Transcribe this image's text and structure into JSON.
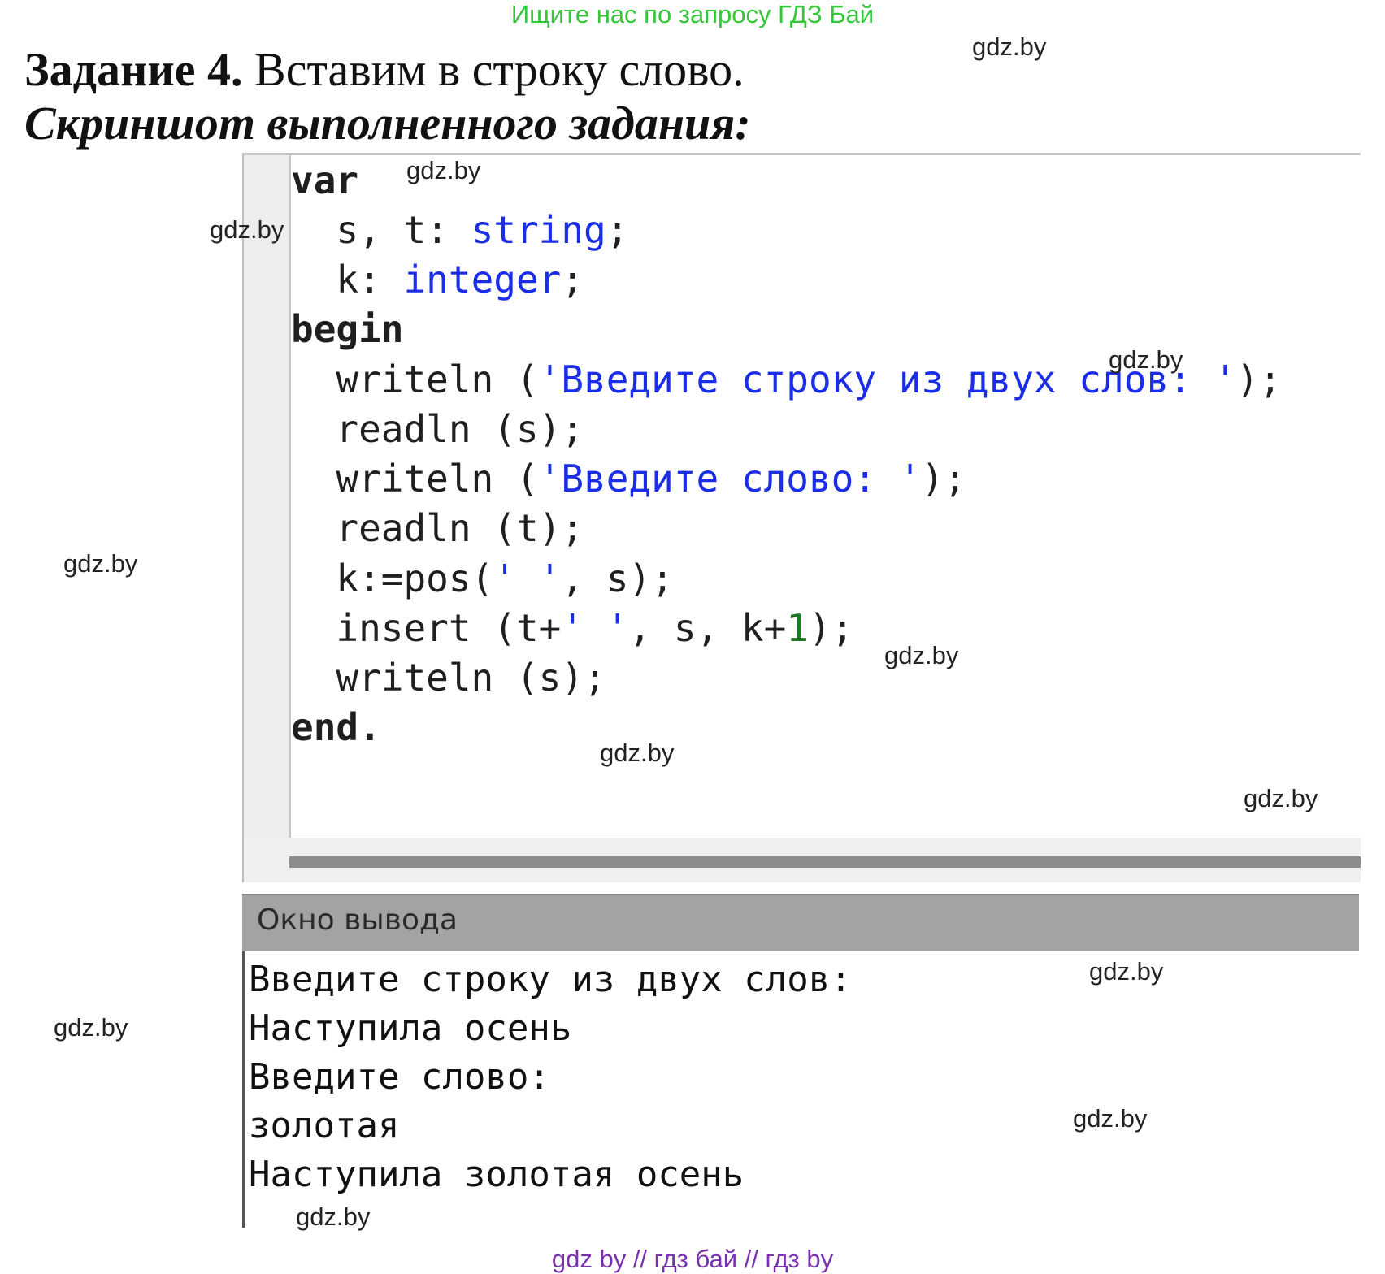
{
  "banner_top": "Ищите нас по запросу ГДЗ Бай",
  "banner_bottom": "gdz by  //  гдз бай  //  гдз by",
  "heading": {
    "bold": "Задание 4.",
    "text": " Вставим в строку слово."
  },
  "subheading": "Скриншот выполненного задания:",
  "watermark": "gdz.by",
  "code": {
    "l1_kw": "var",
    "l2_pre": "  s, t: ",
    "l2_type": "string",
    "l2_post": ";",
    "l3_pre": "  k: ",
    "l3_type": "integer",
    "l3_post": ";",
    "l4_kw": "begin",
    "l5_pre": "  writeln (",
    "l5_str": "'Введите строку из двух слов: '",
    "l5_post": ");",
    "l6": "  readln (s);",
    "l7_pre": "  writeln (",
    "l7_str": "'Введите слово: '",
    "l7_post": ");",
    "l8": "  readln (t);",
    "l9_pre": "  k:=pos(",
    "l9_str": "' '",
    "l9_post": ", s);",
    "l10_pre": "  insert (t+",
    "l10_str": "' '",
    "l10_mid": ", s, k+",
    "l10_num": "1",
    "l10_post": ");",
    "l11": "  writeln (s);",
    "l12_kw": "end",
    "l12_post": "."
  },
  "output_window": {
    "title": "Окно вывода",
    "lines": [
      "Введите строку из двух слов:",
      "Наступила осень",
      "Введите слово:",
      "золотая",
      "Наступила золотая осень"
    ]
  }
}
